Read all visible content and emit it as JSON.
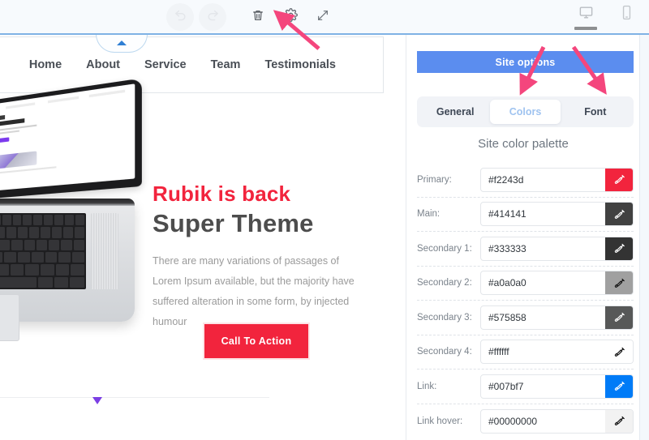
{
  "toolbar": {
    "undo_icon": "undo-arrow-icon",
    "redo_icon": "redo-arrow-icon",
    "delete_icon": "trash-icon",
    "settings_icon": "gear-icon",
    "expand_icon": "expand-arrows-icon",
    "desktop_icon": "desktop-monitor-icon",
    "mobile_icon": "mobile-phone-icon",
    "active_device": "desktop"
  },
  "preview": {
    "collapse_tab_icon": "chevron-up-icon",
    "nav": {
      "items": [
        {
          "label": "Home"
        },
        {
          "label": "About"
        },
        {
          "label": "Service"
        },
        {
          "label": "Team"
        },
        {
          "label": "Testimonials"
        }
      ]
    },
    "hero": {
      "title_line1": "Rubik is back",
      "title_line2": "Super Theme",
      "paragraph": "There are many variations of passages of Lorem Ipsum available, but the majority have suffered alteration in some form, by injected humour",
      "cta_label": "Call To Action",
      "title1_color": "#f2243d",
      "title2_color": "#4d4d4d",
      "cta_color": "#f2243d",
      "laptop_image": "macbook-laptop-photo"
    },
    "section_marker_color": "#7b3fe4"
  },
  "panel": {
    "header": {
      "label": "Site options",
      "color": "#5b8def"
    },
    "tabs": [
      {
        "label": "General",
        "active": false
      },
      {
        "label": "Colors",
        "active": true
      },
      {
        "label": "Font",
        "active": false
      }
    ],
    "palette_title": "Site color palette",
    "colors": [
      {
        "label": "Primary:",
        "value": "#f2243d",
        "swatch": "#f2243d",
        "pipette": "#ffffff"
      },
      {
        "label": "Main:",
        "value": "#414141",
        "swatch": "#414141",
        "pipette": "#ffffff"
      },
      {
        "label": "Secondary 1:",
        "value": "#333333",
        "swatch": "#333333",
        "pipette": "#ffffff"
      },
      {
        "label": "Secondary 2:",
        "value": "#a0a0a0",
        "swatch": "#a0a0a0",
        "pipette": "#111111"
      },
      {
        "label": "Secondary 3:",
        "value": "#575858",
        "swatch": "#575858",
        "pipette": "#ffffff"
      },
      {
        "label": "Secondary 4:",
        "value": "#ffffff",
        "swatch": "#ffffff",
        "pipette": "#111111"
      },
      {
        "label": "Link:",
        "value": "#007bf7",
        "swatch": "#007bf7",
        "pipette": "#ffffff"
      },
      {
        "label": "Link hover:",
        "value": "#00000000",
        "swatch": "#f2f2f2",
        "pipette": "#111111"
      }
    ]
  },
  "annotations": {
    "color": "#f4467d",
    "arrows": [
      {
        "target": "gear-icon"
      },
      {
        "target": "colors-tab"
      },
      {
        "target": "font-tab"
      }
    ]
  }
}
